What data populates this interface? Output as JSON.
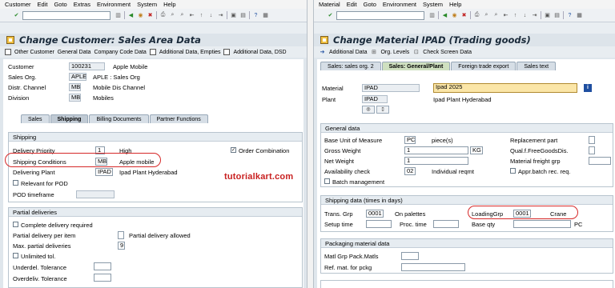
{
  "left": {
    "menu": [
      "Customer",
      "Edit",
      "Goto",
      "Extras",
      "Environment",
      "System",
      "Help"
    ],
    "title": "Change Customer: Sales Area Data",
    "app_toolbar": [
      "Other Customer",
      "General Data",
      "Company Code Data",
      "Additional Data, Empties",
      "Additional Data, DSD"
    ],
    "header": {
      "customer_label": "Customer",
      "customer_value": "100231",
      "customer_desc": "Apple Mobile",
      "salesorg_label": "Sales Org.",
      "salesorg_value": "APLE",
      "salesorg_desc": "APLE : Sales Org",
      "distr_label": "Distr. Channel",
      "distr_value": "MB",
      "distr_desc": "Mobile Dis Channel",
      "division_label": "Division",
      "division_value": "MB",
      "division_desc": "Mobiles"
    },
    "tabs": [
      "Sales",
      "Shipping",
      "Billing Documents",
      "Partner Functions"
    ],
    "shipping": {
      "group": "Shipping",
      "priority_label": "Delivery Priority",
      "priority_value": "1",
      "priority_desc": "High",
      "order_comb": "Order Combination",
      "cond_label": "Shipping Conditions",
      "cond_value": "MB",
      "cond_desc": "Apple mobile",
      "plant_label": "Delivering Plant",
      "plant_value": "IPAD",
      "plant_desc": "Ipad Plant Hyderabad",
      "pod_relevant": "Relevant for POD",
      "pod_timeframe": "POD timeframe"
    },
    "partial": {
      "group": "Partial deliveries",
      "complete": "Complete delivery required",
      "per_item": "Partial delivery per item",
      "allowed": "Partial delivery allowed",
      "max_label": "Max. partial deliveries",
      "max_value": "9",
      "unlimited": "Unlimited tol.",
      "under": "Underdel. Tolerance",
      "over": "Overdeliv. Tolerance"
    }
  },
  "right": {
    "menu": [
      "Material",
      "Edit",
      "Goto",
      "Environment",
      "System",
      "Help"
    ],
    "title": "Change Material IPAD (Trading goods)",
    "app_toolbar": [
      "Additional Data",
      "Org. Levels",
      "Check Screen Data"
    ],
    "tabs": [
      "Sales: sales org. 2",
      "Sales: General/Plant",
      "Foreign trade export",
      "Sales text"
    ],
    "material_label": "Material",
    "material_value": "IPAD",
    "material_desc": "Ipad 2025",
    "plant_label": "Plant",
    "plant_value": "IPAD",
    "plant_desc": "Ipad Plant Hyderabad",
    "general": {
      "group": "General data",
      "base_uom_label": "Base Unit of Measure",
      "base_uom_value": "PC",
      "base_uom_desc": "piece(s)",
      "replacement": "Replacement part",
      "gross_label": "Gross Weight",
      "gross_value": "1",
      "gross_unit": "KG",
      "qual": "Qual.f.FreeGoodsDis.",
      "net_label": "Net Weight",
      "net_value": "1",
      "freight": "Material freight grp",
      "avail_label": "Availability check",
      "avail_value": "02",
      "avail_desc": "Individual reqmt",
      "appr": "Appr.batch rec. req.",
      "batch": "Batch management"
    },
    "shipping": {
      "group": "Shipping data (times in days)",
      "trans_label": "Trans. Grp",
      "trans_value": "0001",
      "trans_desc": "On palettes",
      "loading_label": "LoadingGrp",
      "loading_value": "0001",
      "loading_desc": "Crane",
      "setup": "Setup time",
      "proc": "Proc. time",
      "baseqty": "Base qty",
      "pc": "PC"
    },
    "packaging": {
      "group": "Packaging material data",
      "matl_grp": "Matl Grp Pack.Matls",
      "ref_mat": "Ref. mat. for pckg"
    }
  },
  "watermark": "tutorialkart.com",
  "colors": {
    "highlight": "#d62828",
    "accent": "#1f4fa0",
    "material_desc_bg": "#fbe6a8"
  }
}
